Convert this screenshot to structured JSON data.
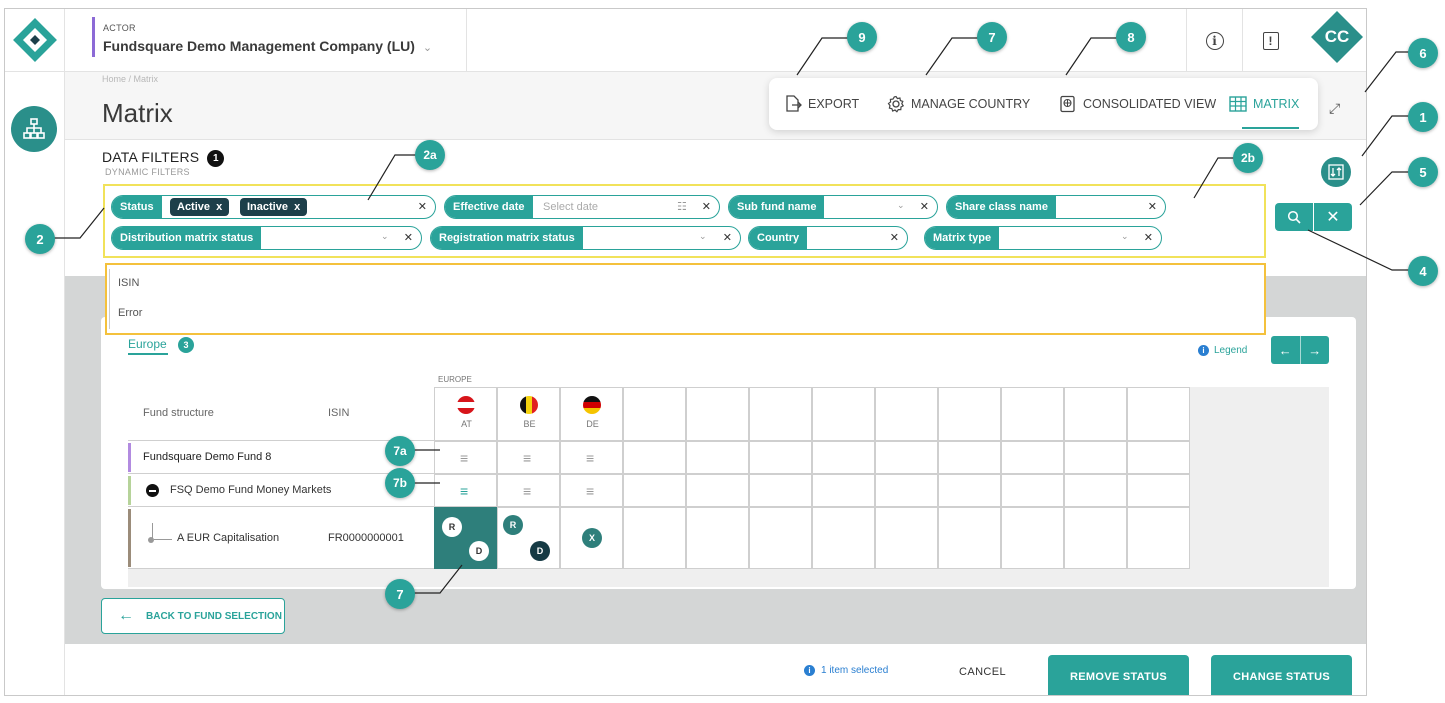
{
  "topbar": {
    "actor_label": "ACTOR",
    "actor_name": "Fundsquare Demo Management Company (LU)",
    "avatar_initials": "CC"
  },
  "header": {
    "breadcrumb": "Home  /  Matrix",
    "title": "Matrix",
    "toolbar": {
      "export": "EXPORT",
      "manage_country": "MANAGE COUNTRY",
      "consolidated_view": "CONSOLIDATED VIEW",
      "matrix": "MATRIX"
    }
  },
  "filters": {
    "title": "DATA FILTERS",
    "badge": "1",
    "subtitle": "DYNAMIC FILTERS",
    "status": {
      "label": "Status",
      "tags": [
        "Active",
        "Inactive"
      ]
    },
    "effective_date": {
      "label": "Effective date",
      "placeholder": "Select date"
    },
    "sub_fund_name": {
      "label": "Sub fund name"
    },
    "share_class_name": {
      "label": "Share class name"
    },
    "distribution_matrix_status": {
      "label": "Distribution matrix status"
    },
    "registration_matrix_status": {
      "label": "Registration matrix status"
    },
    "country": {
      "label": "Country"
    },
    "matrix_type": {
      "label": "Matrix type"
    },
    "dropdown_options": [
      "ISIN",
      "Error"
    ]
  },
  "matrix": {
    "region_tab": "Europe",
    "region_badge": "3",
    "legend": "Legend",
    "region_header": "EUROPE",
    "col_fund_structure": "Fund structure",
    "col_isin": "ISIN",
    "countries": [
      "AT",
      "BE",
      "DE"
    ],
    "rows": [
      {
        "name": "Fundsquare Demo Fund 8"
      },
      {
        "name": "FSQ Demo Fund Money Markets"
      },
      {
        "name": "A EUR Capitalisation",
        "isin": "FR0000000001"
      }
    ],
    "statuses": {
      "at": [
        "R",
        "D"
      ],
      "be": [
        "R",
        "D"
      ],
      "de": [
        "X"
      ]
    }
  },
  "footer": {
    "back": "BACK TO FUND SELECTION",
    "selection_info": "1 item selected",
    "cancel": "CANCEL",
    "remove_status": "REMOVE STATUS",
    "change_status": "CHANGE STATUS"
  },
  "callouts": [
    "9",
    "7",
    "8",
    "6",
    "1",
    "5",
    "4",
    "2",
    "2a",
    "2b",
    "7a",
    "7b",
    "7"
  ],
  "colors": {
    "accent": "#2aa39a",
    "dark_teal": "#2a8f8a",
    "tag_dark": "#1d3f4a",
    "highlight_yellow": "#f1e25a",
    "highlight_orange": "#f4c13c"
  }
}
